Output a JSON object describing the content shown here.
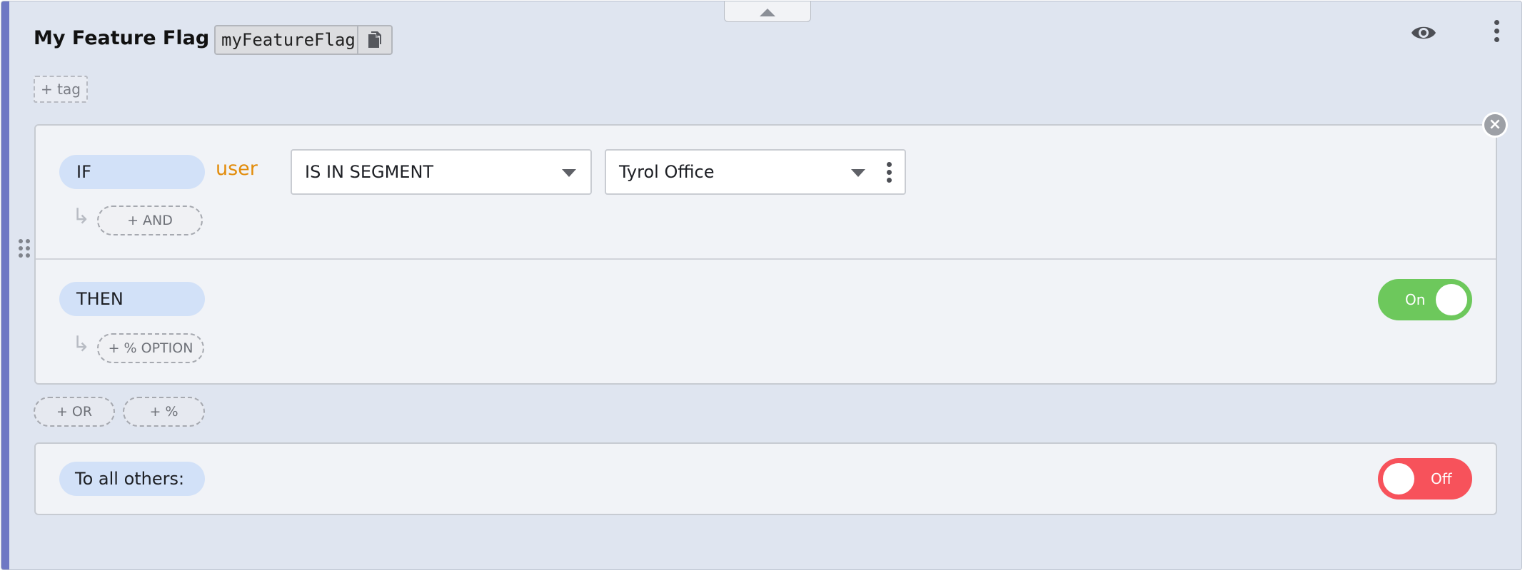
{
  "flag": {
    "name": "My Feature Flag",
    "key": "myFeatureFlag",
    "add_tag_label": "+ tag"
  },
  "icons": {
    "collapse": "chevron-up-icon",
    "copy": "copy-icon",
    "visibility": "eye-icon",
    "menu": "more-vertical-icon",
    "remove_rule": "close-icon",
    "drag": "drag-handle-icon",
    "sub_arrow": "subdirectory-arrow-icon"
  },
  "rule": {
    "if_label": "IF",
    "attribute": "user",
    "comparator": "IS IN SEGMENT",
    "segment": "Tyrol Office",
    "sub_arrow_glyph": "↳",
    "add_and_label": "+ AND",
    "then_label": "THEN",
    "add_option_label": "+ % OPTION",
    "toggle_label": "On",
    "toggle_state": true
  },
  "actions": {
    "add_or_label": "+ OR",
    "add_percent_label": "+ %"
  },
  "default_rule": {
    "label": "To all others:",
    "toggle_label": "Off",
    "toggle_state": false
  },
  "colors": {
    "card_bg": "#dfe5f0",
    "accent_bar": "#6e78c4",
    "pill_bg": "#d2e1f8",
    "attribute_text": "#e28c0b",
    "toggle_on": "#6dc85c",
    "toggle_off": "#f7525b"
  }
}
